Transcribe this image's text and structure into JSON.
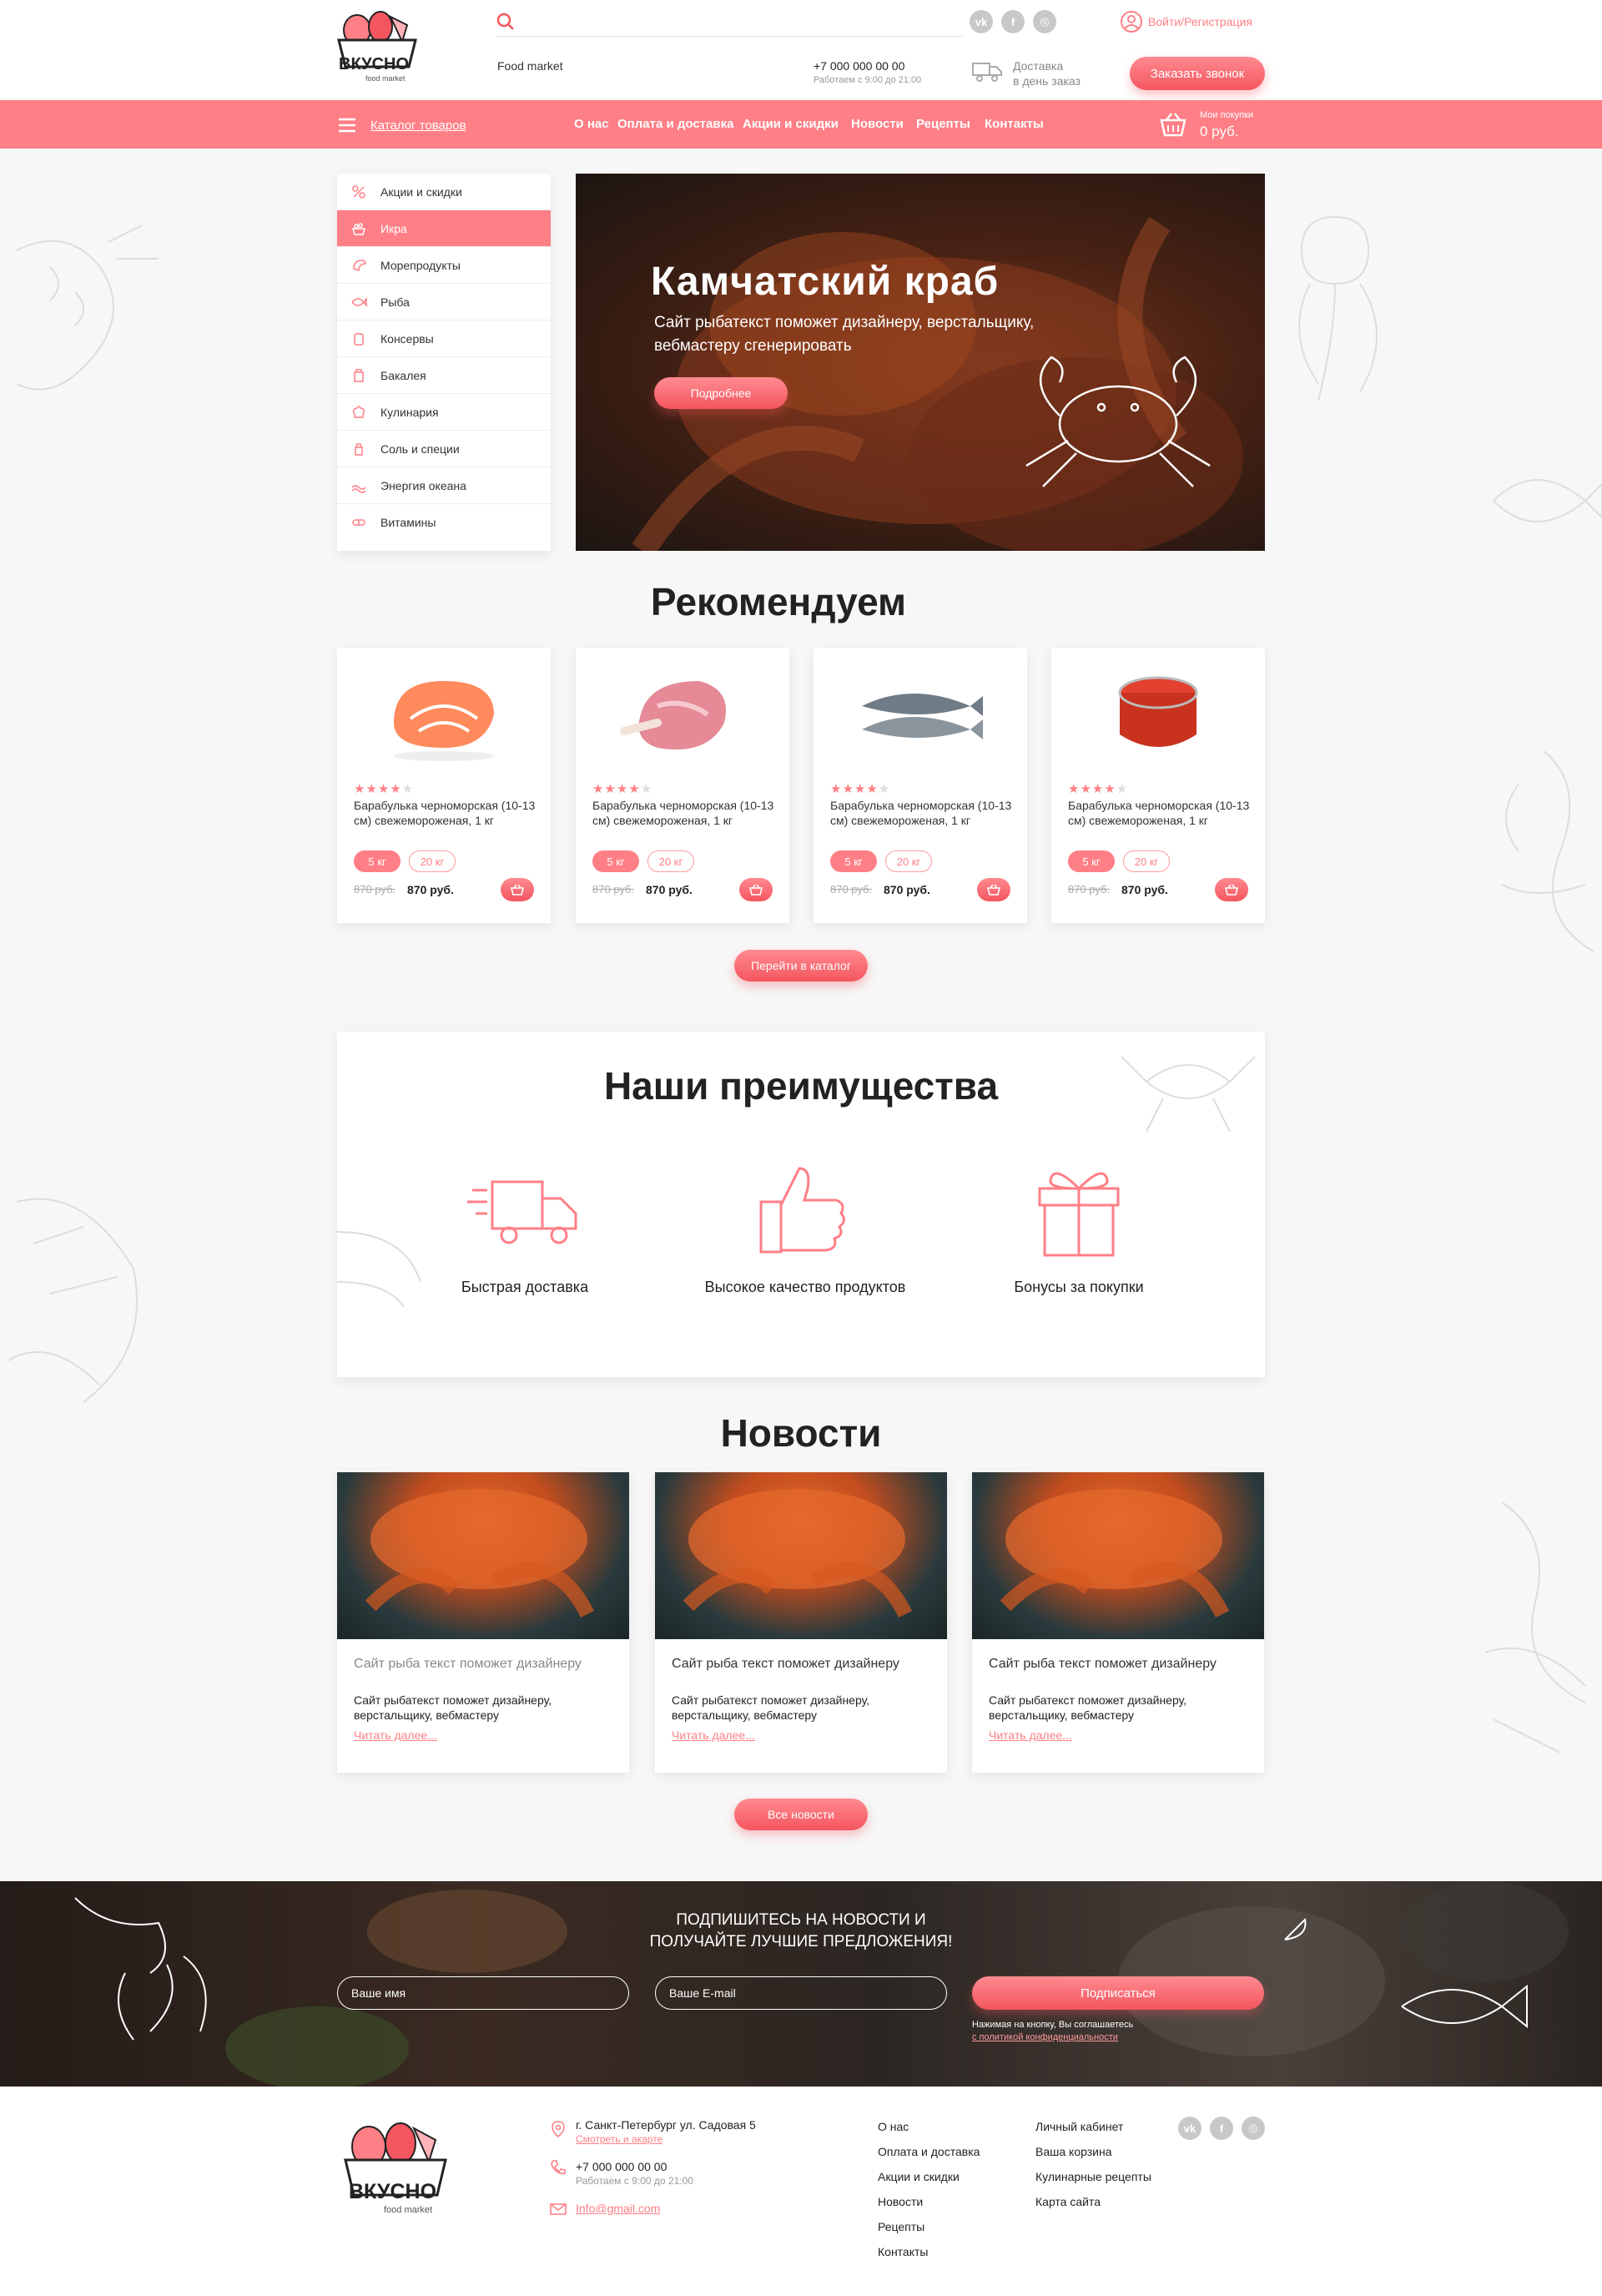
{
  "colors": {
    "accent": "#ff7f86",
    "accent_dark": "#f4565f",
    "background": "#f7f7f7"
  },
  "header": {
    "logo_text": "ВКУСНО",
    "logo_sub": "food market",
    "tagline": "Food market",
    "phone": "+7 000 000 00 00",
    "hours": "Работаем с 9:00 до 21:00",
    "delivery_line1": "Доставка",
    "delivery_line2": "в день заказ",
    "login": "Войти/Регистрация",
    "callback_button": "Заказать звонок",
    "social": [
      "vk-icon",
      "facebook-icon",
      "instagram-icon"
    ]
  },
  "nav": {
    "catalog": "Каталог товаров",
    "links": [
      "О нас",
      "Оплата и доставка",
      "Акции и скидки",
      "Новости",
      "Рецепты",
      "Контакты"
    ],
    "cart_label": "Мои покупки",
    "cart_total": "0 руб."
  },
  "sidebar": {
    "items": [
      {
        "label": "Акции и скидки",
        "icon": "discount-icon",
        "active": false
      },
      {
        "label": "Икра",
        "icon": "caviar-icon",
        "active": true
      },
      {
        "label": "Морепродукты",
        "icon": "shrimp-icon",
        "active": false
      },
      {
        "label": "Рыба",
        "icon": "fish-icon",
        "active": false
      },
      {
        "label": "Консервы",
        "icon": "can-icon",
        "active": false
      },
      {
        "label": "Бакалея",
        "icon": "grocery-icon",
        "active": false
      },
      {
        "label": "Кулинария",
        "icon": "chef-hat-icon",
        "active": false
      },
      {
        "label": "Соль и специи",
        "icon": "spice-icon",
        "active": false
      },
      {
        "label": "Энергия океана",
        "icon": "ocean-icon",
        "active": false
      },
      {
        "label": "Витамины",
        "icon": "vitamin-icon",
        "active": false
      }
    ]
  },
  "hero": {
    "title": "Камчатский краб",
    "subtitle": "Сайт рыбатекст поможет дизайнеру, верстальщику, вебмастеру сгенерировать",
    "button": "Подробнее"
  },
  "recommend": {
    "title": "Рекомендуем",
    "products": [
      {
        "image": "salmon-steak",
        "rating": 4,
        "name": "Барабулька черноморская (10-13 см) свежемороженая, 1 кг",
        "size1": "5 кг",
        "size2": "20 кг",
        "old_price": "870 руб.",
        "price": "870 руб."
      },
      {
        "image": "meat-cutlet",
        "rating": 4,
        "name": "Барабулька черноморская (10-13 см) свежемороженая, 1 кг",
        "size1": "5 кг",
        "size2": "20 кг",
        "old_price": "870 руб.",
        "price": "870 руб."
      },
      {
        "image": "two-fish",
        "rating": 4,
        "name": "Барабулька черноморская (10-13 см) свежемороженая, 1 кг",
        "size1": "5 кг",
        "size2": "20 кг",
        "old_price": "870 руб.",
        "price": "870 руб."
      },
      {
        "image": "caviar-jar",
        "rating": 4,
        "name": "Барабулька черноморская (10-13 см) свежемороженая, 1 кг",
        "size1": "5 кг",
        "size2": "20 кг",
        "old_price": "870 руб.",
        "price": "870 руб."
      }
    ],
    "catalog_button": "Перейти в каталог"
  },
  "advantages": {
    "title": "Наши преимущества",
    "items": [
      {
        "icon": "delivery-truck-icon",
        "label": "Быстрая доставка"
      },
      {
        "icon": "thumbs-up-icon",
        "label": "Высокое качество продуктов"
      },
      {
        "icon": "gift-icon",
        "label": "Бонусы за покупки"
      }
    ]
  },
  "news": {
    "title": "Новости",
    "items": [
      {
        "title": "Сайт рыба текст поможет дизайнеру",
        "text": "Сайт рыбатекст поможет дизайнеру, верстальщику, вебмастеру",
        "more": "Читать далее..."
      },
      {
        "title": "Сайт рыба текст поможет дизайнеру",
        "text": "Сайт рыбатекст поможет дизайнеру, верстальщику, вебмастеру",
        "more": "Читать далее..."
      },
      {
        "title": "Сайт рыба текст поможет дизайнеру",
        "text": "Сайт рыбатекст поможет дизайнеру, верстальщику, вебмастеру",
        "more": "Читать далее..."
      }
    ],
    "all_button": "Все новости"
  },
  "subscribe": {
    "title_line1": "ПОДПИШИТЕСЬ НА НОВОСТИ И",
    "title_line2": "ПОЛУЧАЙТЕ ЛУЧШИЕ ПРЕДЛОЖЕНИЯ!",
    "name_placeholder": "Ваше имя",
    "email_placeholder": "Ваше E-mail",
    "button": "Подписаться",
    "note": "Нажимая на кнопку, Вы соглашаетесь",
    "note_link": "с политикой конфиденциальности"
  },
  "footer": {
    "address": "г. Санкт-Петербург ул. Садовая 5",
    "map_link": "Смотреть и акарте",
    "phone": "+7 000 000 00 00",
    "hours": "Работаем с 9:00 до 21:00",
    "email": "Info@gmail.com",
    "col1": [
      "О нас",
      "Оплата и доставка",
      "Акции и скидки",
      "Новости",
      "Рецепты",
      "Контакты"
    ],
    "col2": [
      "Личный кабинет",
      "Ваша корзина",
      "Кулинарные рецепты",
      "Карта сайта"
    ]
  }
}
